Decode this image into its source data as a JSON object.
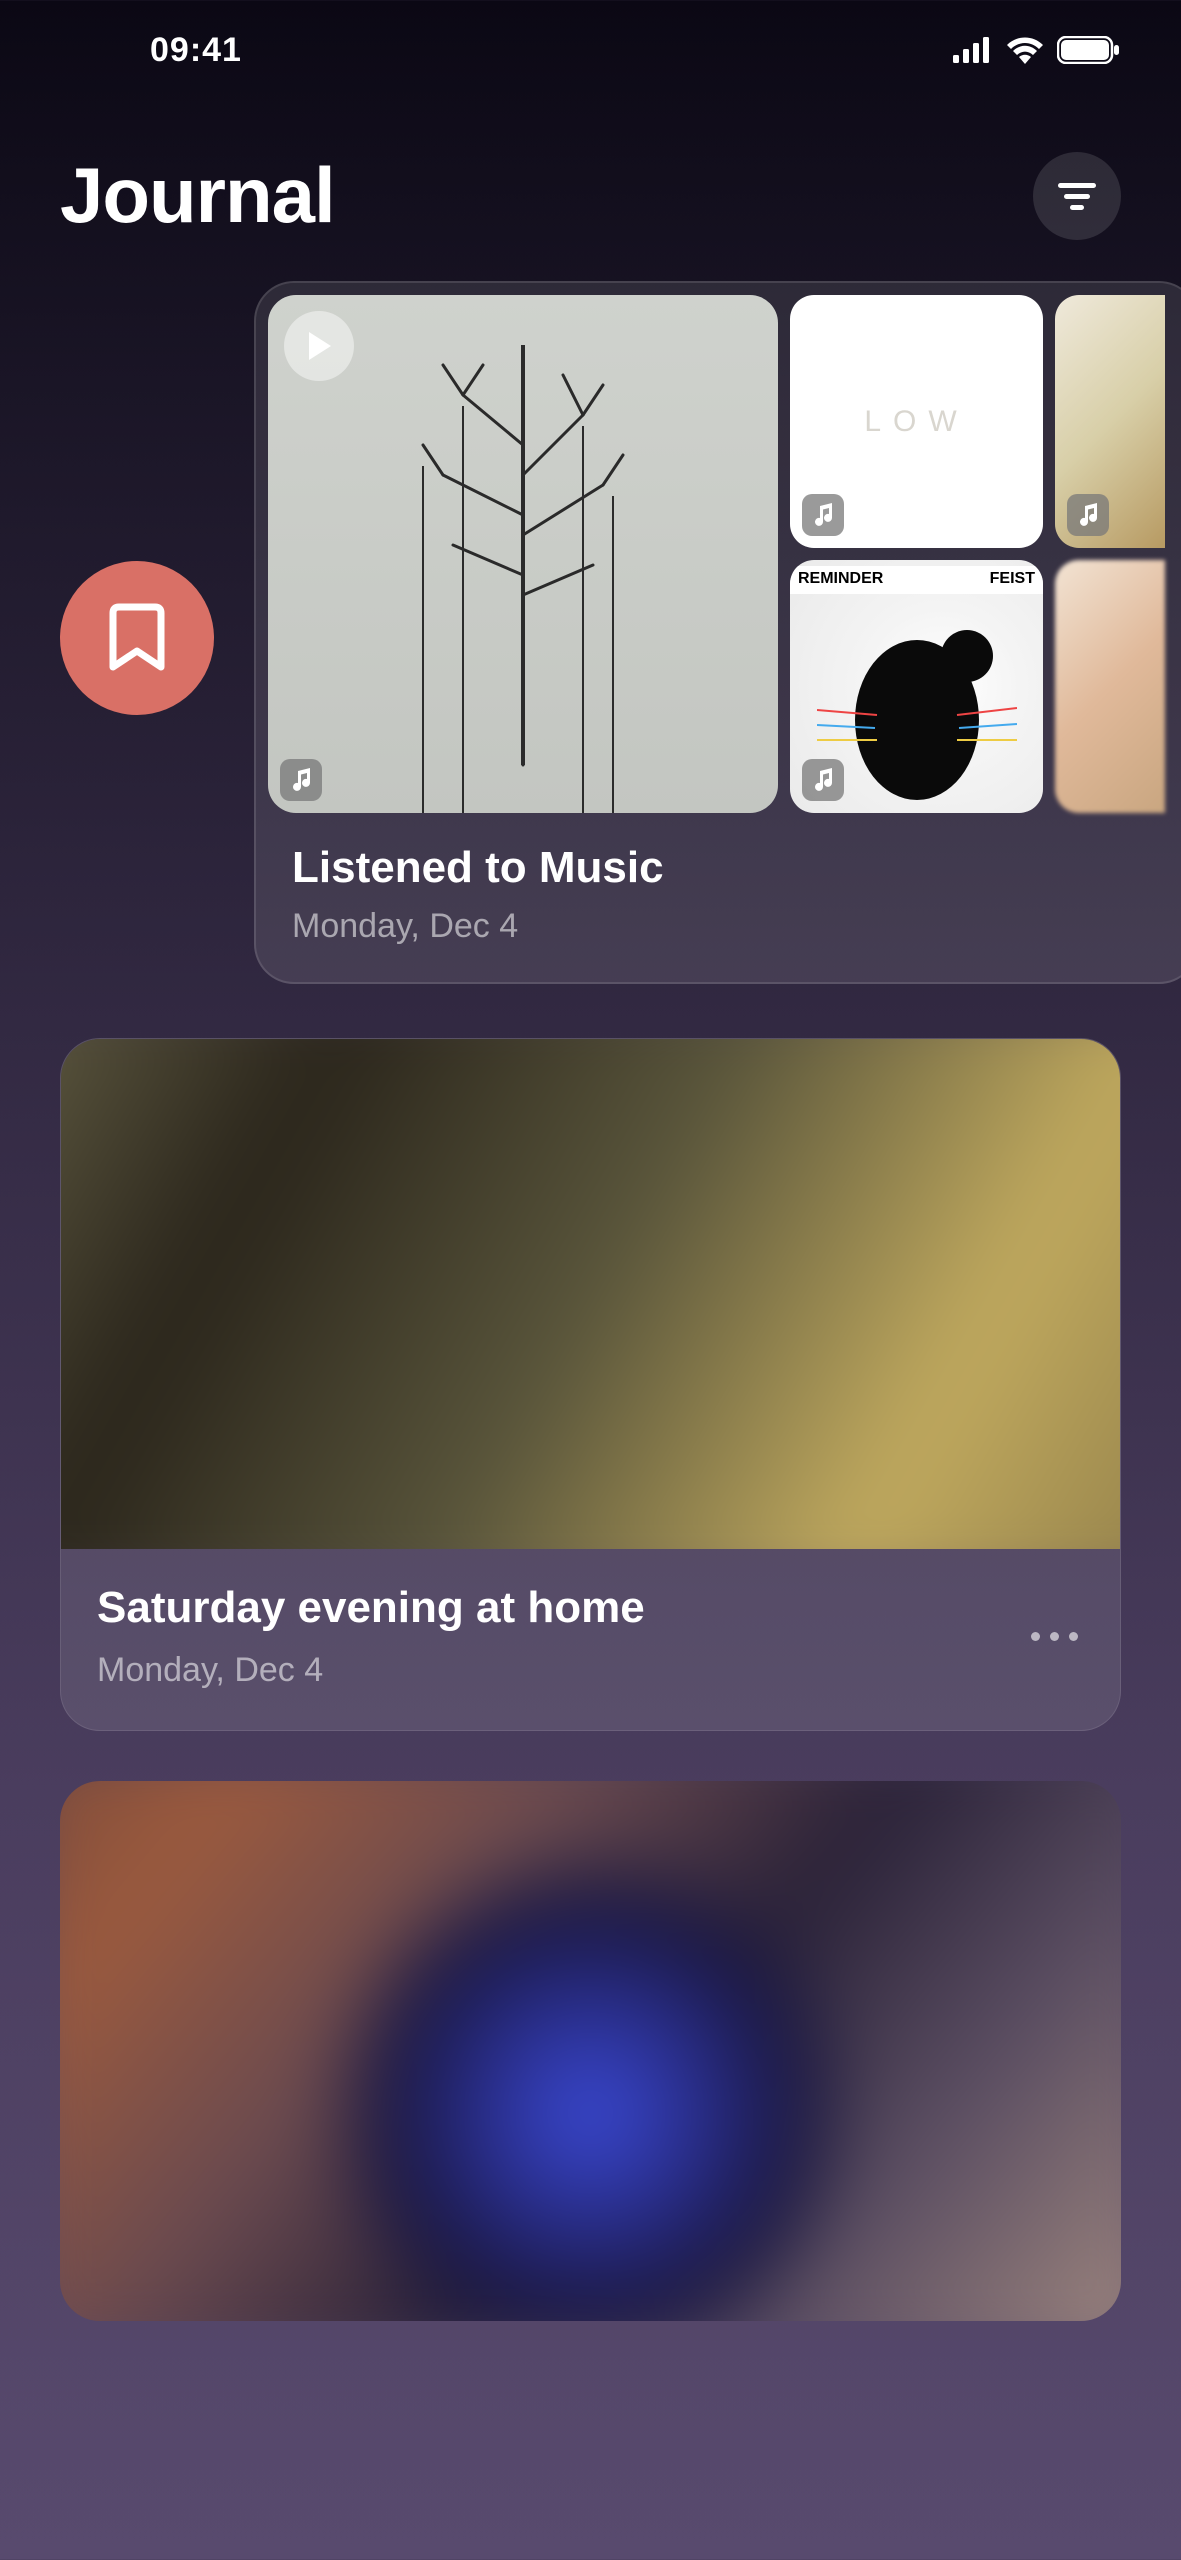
{
  "status": {
    "time": "09:41"
  },
  "header": {
    "title": "Journal"
  },
  "entries": [
    {
      "type": "music",
      "title": "Listened to Music",
      "date": "Monday, Dec 4",
      "bookmarked": true,
      "albums": {
        "large_low_text": "LOW",
        "feist_left": "REMINDER",
        "feist_right": "FEIST"
      }
    },
    {
      "type": "photo",
      "title": "Saturday evening at home",
      "date": "Monday, Dec 4"
    },
    {
      "type": "photo",
      "title": "",
      "date": ""
    }
  ]
}
